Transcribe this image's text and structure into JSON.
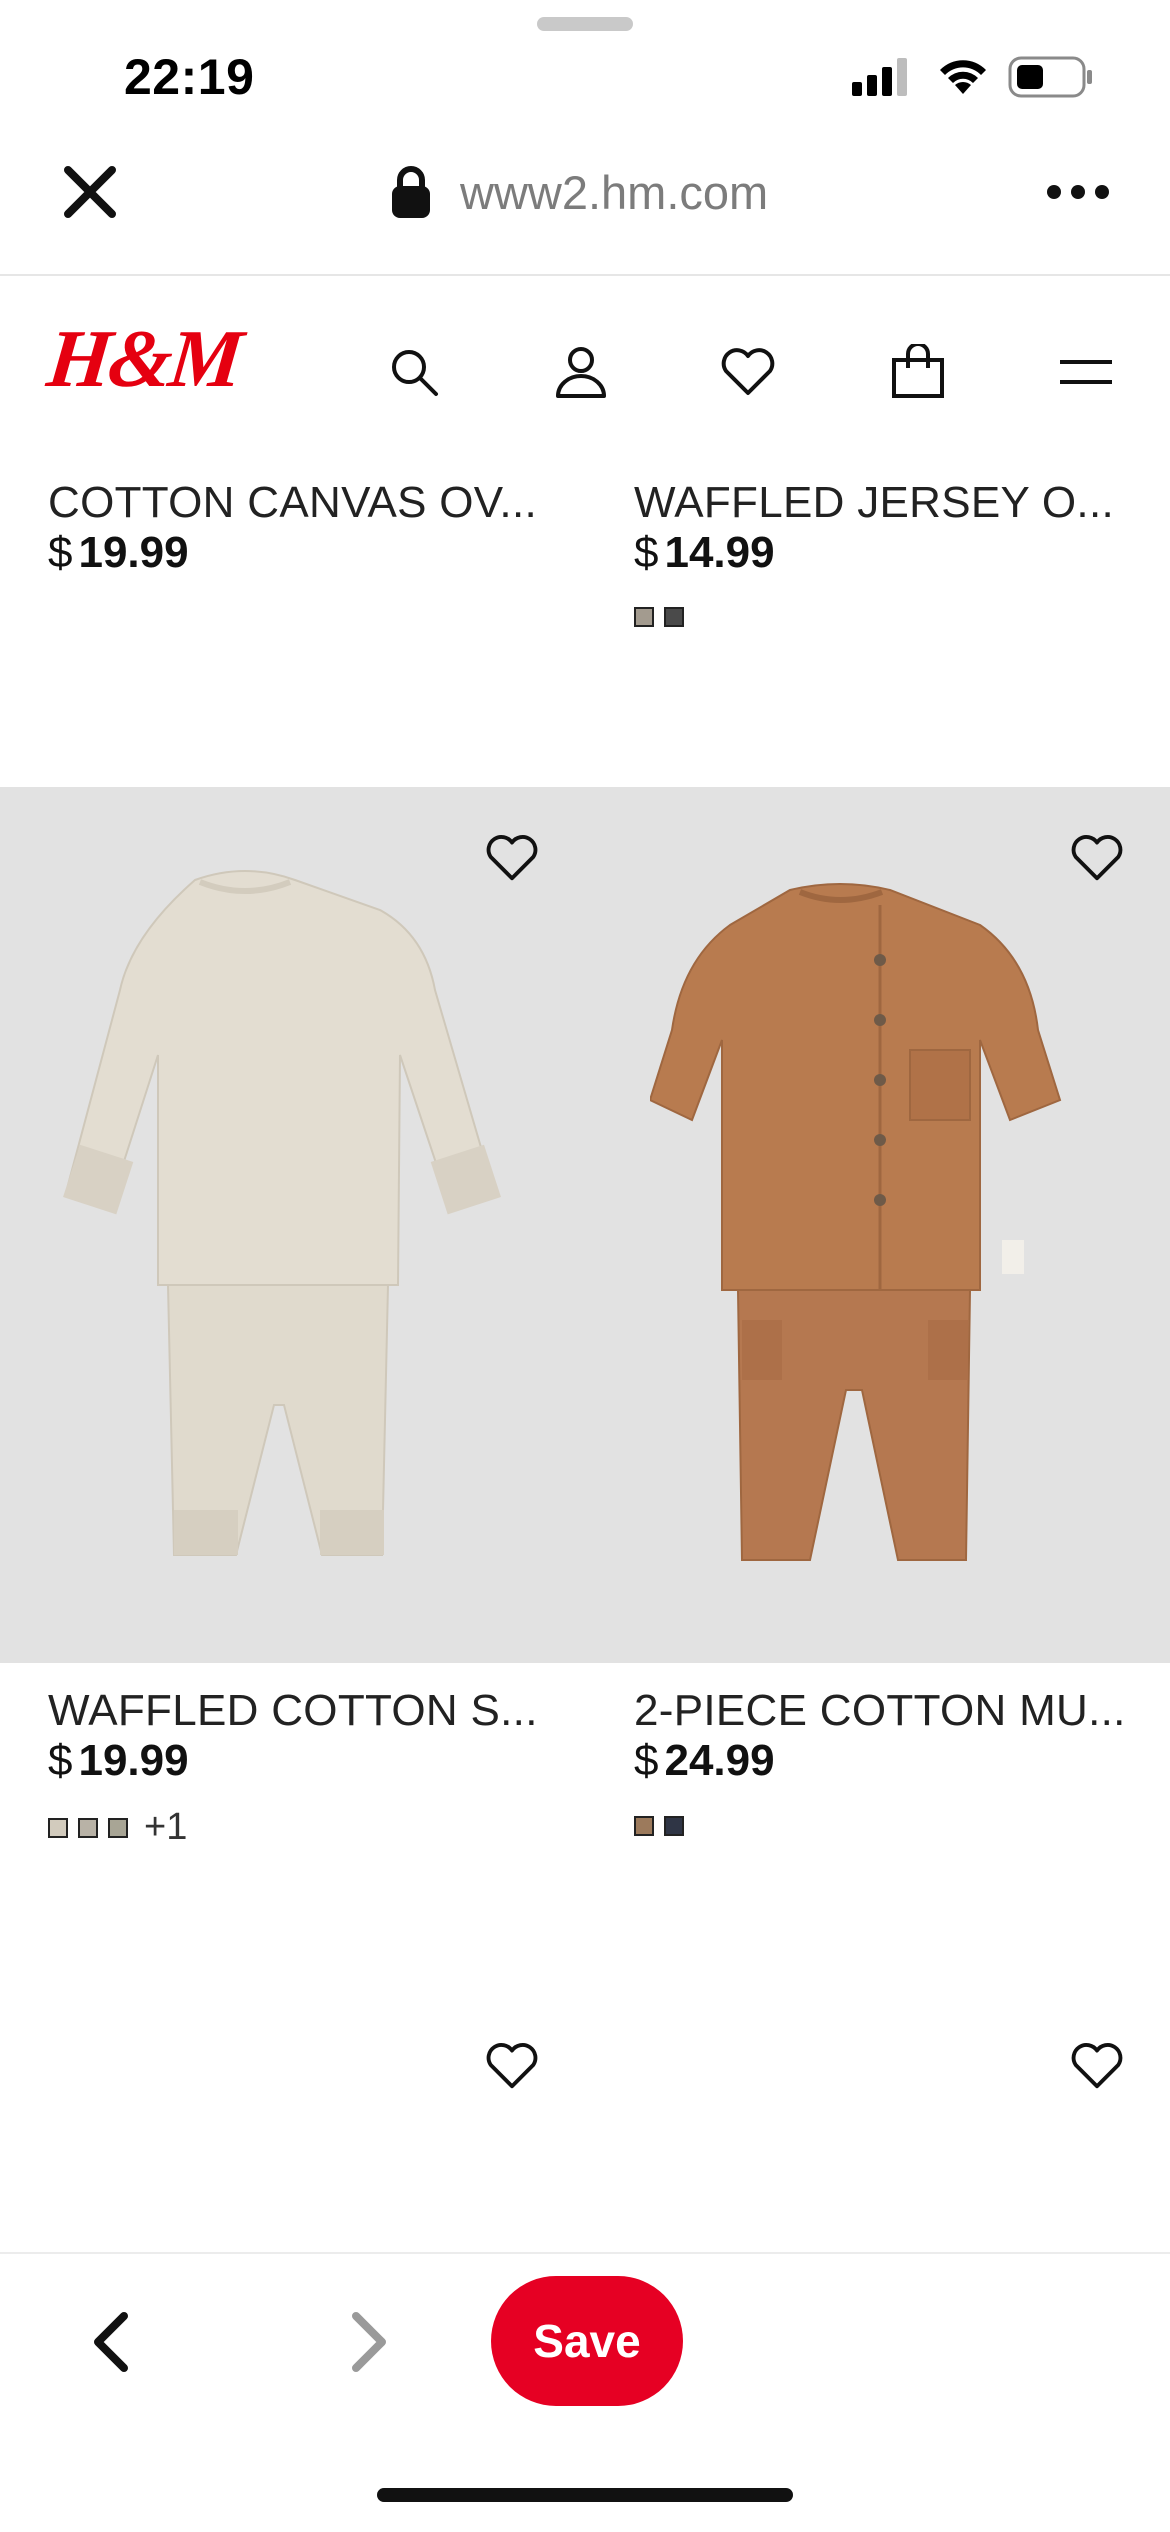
{
  "status_bar": {
    "time": "22:19"
  },
  "browser": {
    "url": "www2.hm.com",
    "close_icon": "close-icon",
    "lock_icon": "lock-icon",
    "more_icon": "more-icon"
  },
  "site_header": {
    "logo_text": "H&M",
    "brand_color": "#e50010",
    "icons": [
      "search-icon",
      "account-icon",
      "favorites-icon",
      "shopping-bag-icon",
      "menu-icon"
    ]
  },
  "products": [
    {
      "name": "COTTON CANVAS OV...",
      "currency": "$",
      "price": "19.99",
      "swatches": []
    },
    {
      "name": "WAFFLED JERSEY O...",
      "currency": "$",
      "price": "14.99",
      "swatches": [
        "#a39b8f",
        "#4a4a4a"
      ]
    },
    {
      "name": "WAFFLED COTTON S...",
      "currency": "$",
      "price": "19.99",
      "swatches": [
        "#d2cbbd",
        "#b8b2a6",
        "#a8a595"
      ],
      "more_colors": "+1"
    },
    {
      "name": "2-PIECE COTTON MU...",
      "currency": "$",
      "price": "24.99",
      "swatches": [
        "#9c7a5c",
        "#2f3545"
      ]
    }
  ],
  "image_panel_color": "#e2e2e2",
  "toolbar": {
    "back_icon": "chevron-left-icon",
    "forward_icon": "chevron-right-icon",
    "save_label": "Save",
    "save_color": "#e60023"
  }
}
